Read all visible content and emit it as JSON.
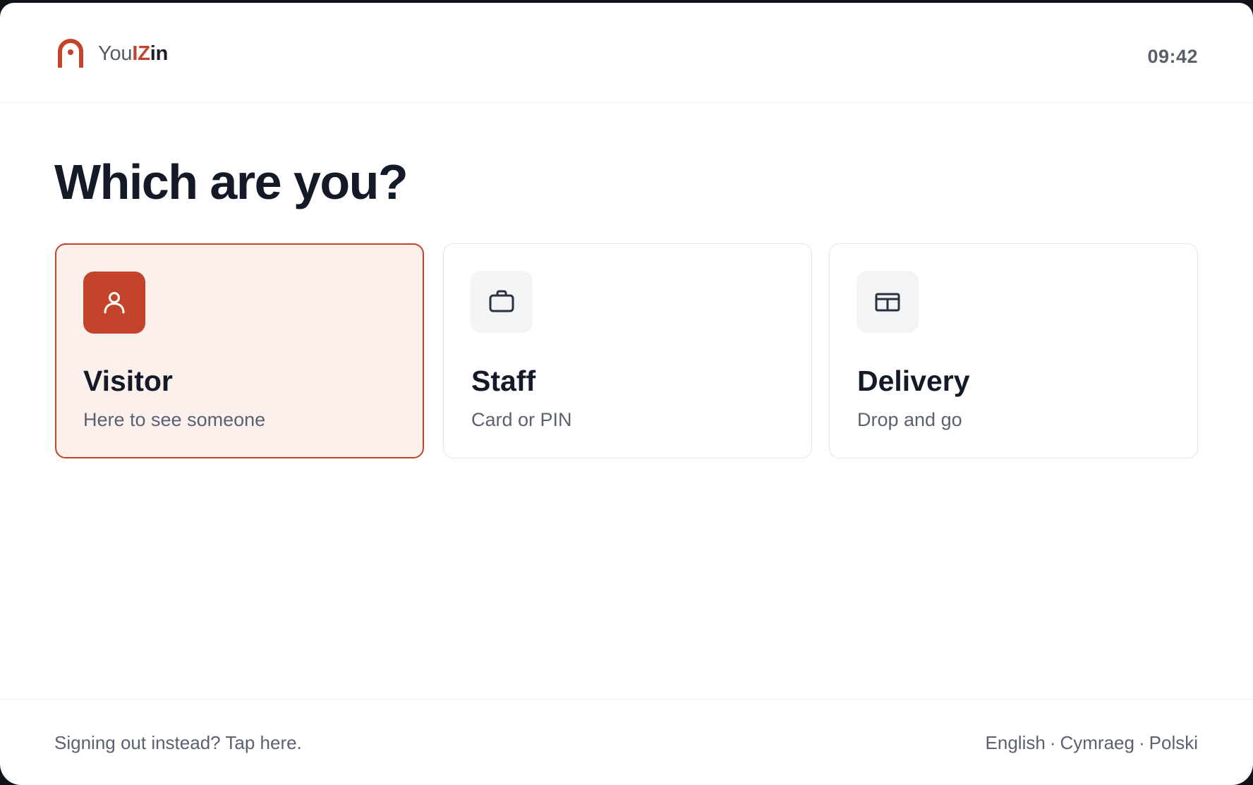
{
  "header": {
    "brand_prefix": "You",
    "brand_accent": "IZ",
    "brand_suffix": "in",
    "clock": "09:42"
  },
  "main": {
    "heading": "Which are you?",
    "options": [
      {
        "title": "Visitor",
        "subtitle": "Here to see someone",
        "icon": "person-icon",
        "selected": true
      },
      {
        "title": "Staff",
        "subtitle": "Card or PIN",
        "icon": "briefcase-icon",
        "selected": false
      },
      {
        "title": "Delivery",
        "subtitle": "Drop and go",
        "icon": "package-icon",
        "selected": false
      }
    ]
  },
  "footer": {
    "signout_text": "Signing out instead? Tap here.",
    "languages": [
      "English",
      "Cymraeg",
      "Polski"
    ],
    "separator": "·"
  },
  "colors": {
    "accent": "#c4432b",
    "selected_background": "#fcf0ed",
    "heading_text": "#151a28",
    "muted_text": "#5b6170"
  }
}
